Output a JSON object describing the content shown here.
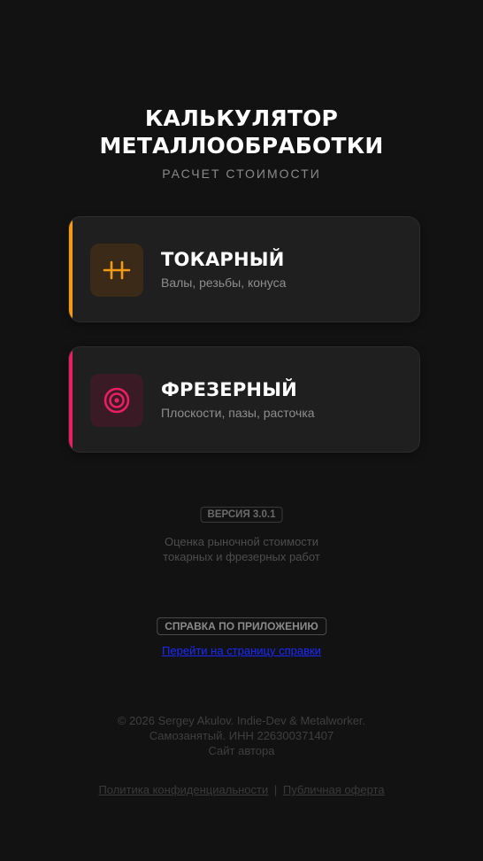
{
  "header": {
    "title_line1": "КАЛЬКУЛЯТОР",
    "title_line2": "МЕТАЛЛООБРАБОТКИ",
    "subtitle": "РАСЧЕТ СТОИМОСТИ"
  },
  "cards": [
    {
      "title": "ТОКАРНЫЙ",
      "subtitle": "Валы, резьбы, конуса",
      "accent": "#f39a16",
      "icon": "lathe-icon"
    },
    {
      "title": "ФРЕЗЕРНЫЙ",
      "subtitle": "Плоскости, пазы, расточка",
      "accent": "#e91e63",
      "icon": "target-icon"
    }
  ],
  "version": {
    "badge": "ВЕРСИЯ 3.0.1",
    "desc_line1": "Оценка рыночной стоимости",
    "desc_line2": "токарных и фрезерных работ"
  },
  "help": {
    "badge": "СПРАВКА ПО ПРИЛОЖЕНИЮ",
    "link": "Перейти на страницу справки"
  },
  "footer": {
    "copyright": "© 2026 Sergey Akulov. Indie-Dev & Metalworker.",
    "inn": "Самозанятый. ИНН 226300371407",
    "author_site": "Сайт автора"
  },
  "legal": {
    "privacy": "Политика конфиденциальности",
    "separator": "|",
    "offer": "Публичная оферта"
  }
}
